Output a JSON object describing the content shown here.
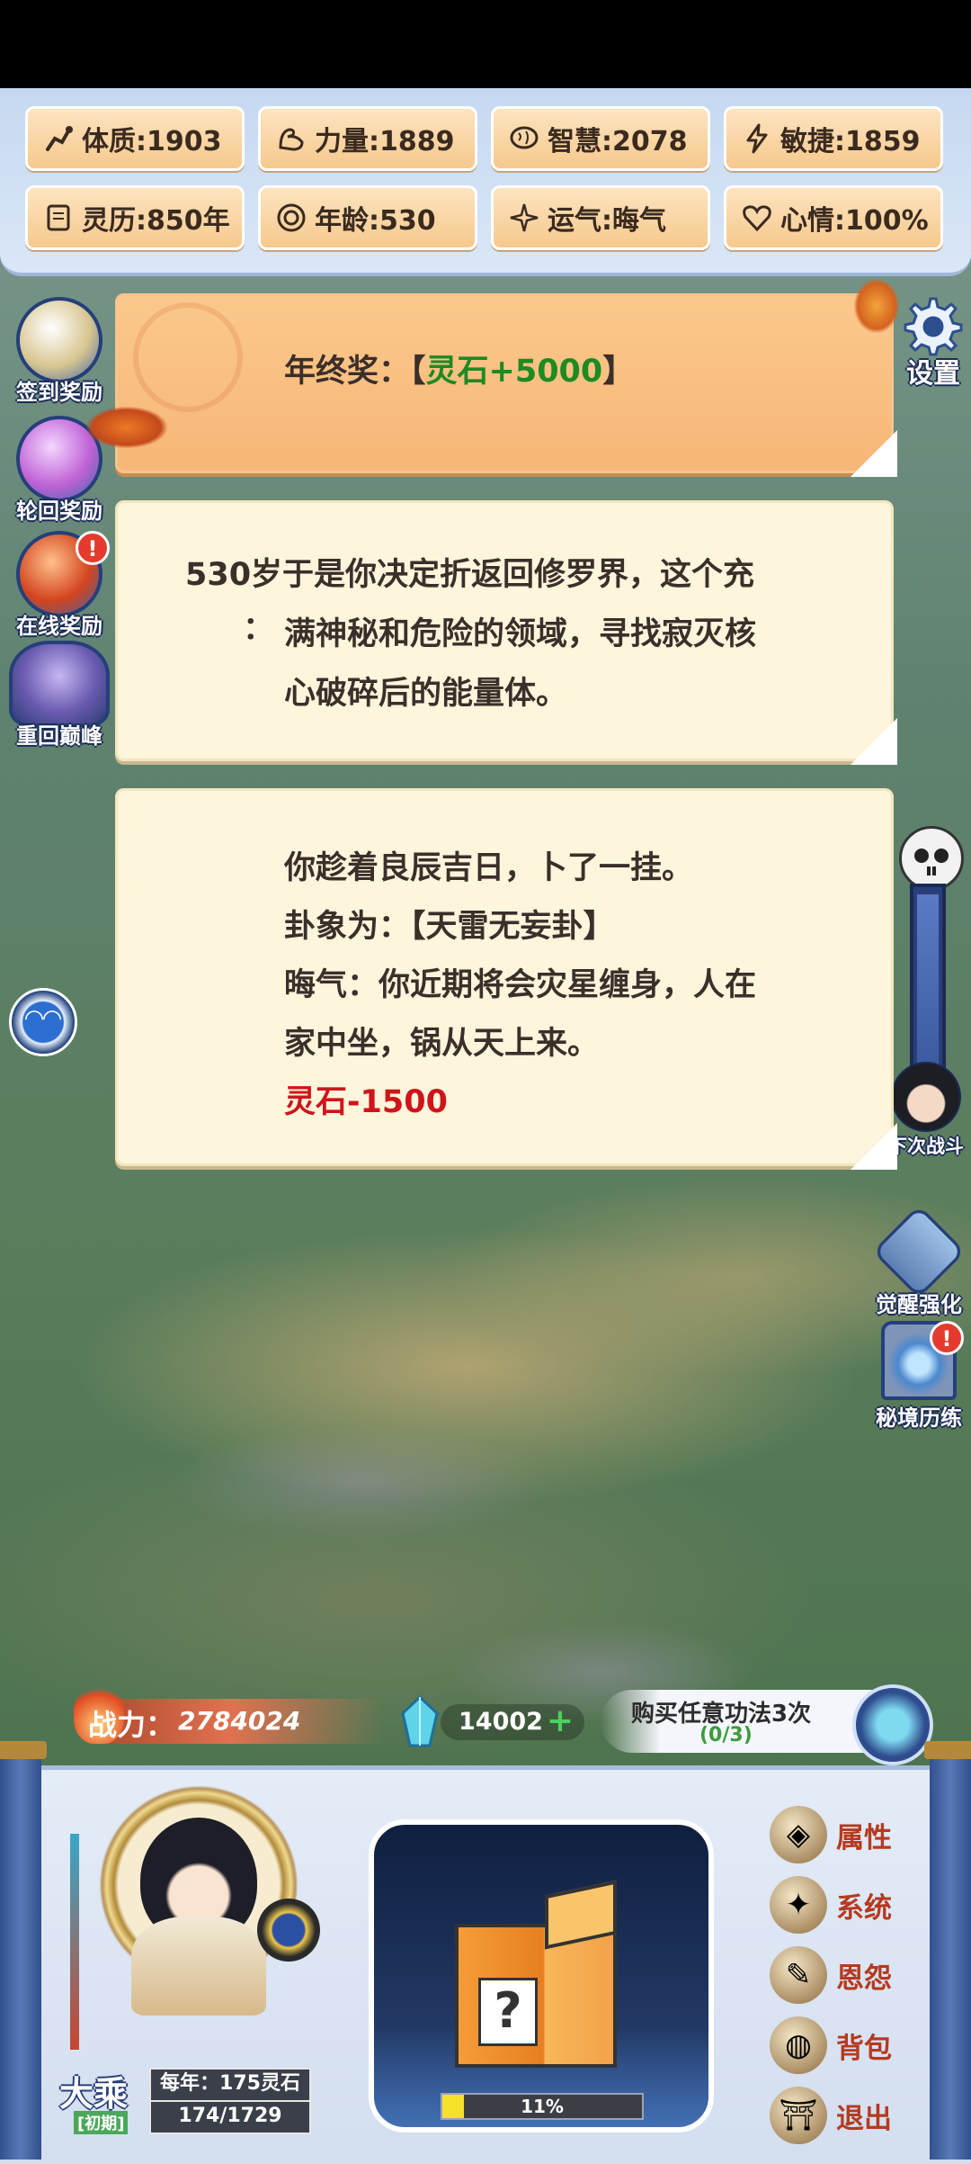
{
  "stats": [
    {
      "label": "体质:1903",
      "icon": "body-icon"
    },
    {
      "label": "力量:1889",
      "icon": "strength-arm-icon"
    },
    {
      "label": "智慧:2078",
      "icon": "brain-icon"
    },
    {
      "label": "敏捷:1859",
      "icon": "lightning-icon"
    },
    {
      "label": "灵历:850年",
      "icon": "scroll-icon"
    },
    {
      "label": "年龄:530",
      "icon": "age-ring-icon"
    },
    {
      "label": "运气:晦气",
      "icon": "sparkle-icon"
    },
    {
      "label": "心情:100%",
      "icon": "heart-icon"
    }
  ],
  "side_left": [
    {
      "label": "签到奖励",
      "badge": ""
    },
    {
      "label": "轮回奖励",
      "badge": ""
    },
    {
      "label": "在线奖励",
      "badge": "!"
    },
    {
      "label": "重回巅峰",
      "badge": ""
    }
  ],
  "side_right": {
    "settings_label": "设置",
    "next_battle_label": "下次战斗",
    "awaken_label": "觉醒强化",
    "secret_label": "秘境历练",
    "secret_badge": "!"
  },
  "cards": {
    "reward": {
      "prefix": "年终奖：【",
      "value": "灵石+5000",
      "suffix": "】"
    },
    "event": {
      "line1": "530岁于是你决定折返回修罗界，这个充",
      "colon": "：",
      "line2": "满神秘和危险的领域，寻找寂灭核",
      "line3": "心破碎后的能量体。"
    },
    "divination": {
      "line1": "你趁着良辰吉日，卜了一挂。",
      "line2": "卦象为：【天雷无妄卦】",
      "line3": "晦气：你近期将会灾星缠身，人在",
      "line4": "家中坐，锅从天上来。",
      "penalty": "灵石-1500"
    }
  },
  "bottom": {
    "power_label": "战力：",
    "power_value": "2784024",
    "spirit_stones": "14002",
    "plus": "+",
    "purchase_title": "购买任意功法3次",
    "purchase_progress": "(0/3)",
    "rank": "大乘",
    "rank_stage": "[初期]",
    "yearly": "每年：175灵石",
    "exp": "174/1729",
    "box_progress": "11%",
    "box_fill": 0.11,
    "menu": [
      {
        "label": "属性",
        "icon": "attribute-icon"
      },
      {
        "label": "系统",
        "icon": "system-icon"
      },
      {
        "label": "恩怨",
        "icon": "grudge-scroll-icon"
      },
      {
        "label": "背包",
        "icon": "bag-icon"
      },
      {
        "label": "退出",
        "icon": "exit-gate-icon"
      }
    ]
  },
  "colors": {
    "reward_green": "#1d8a22",
    "penalty_red": "#d0141b",
    "accent_blue": "#3e64a8"
  }
}
